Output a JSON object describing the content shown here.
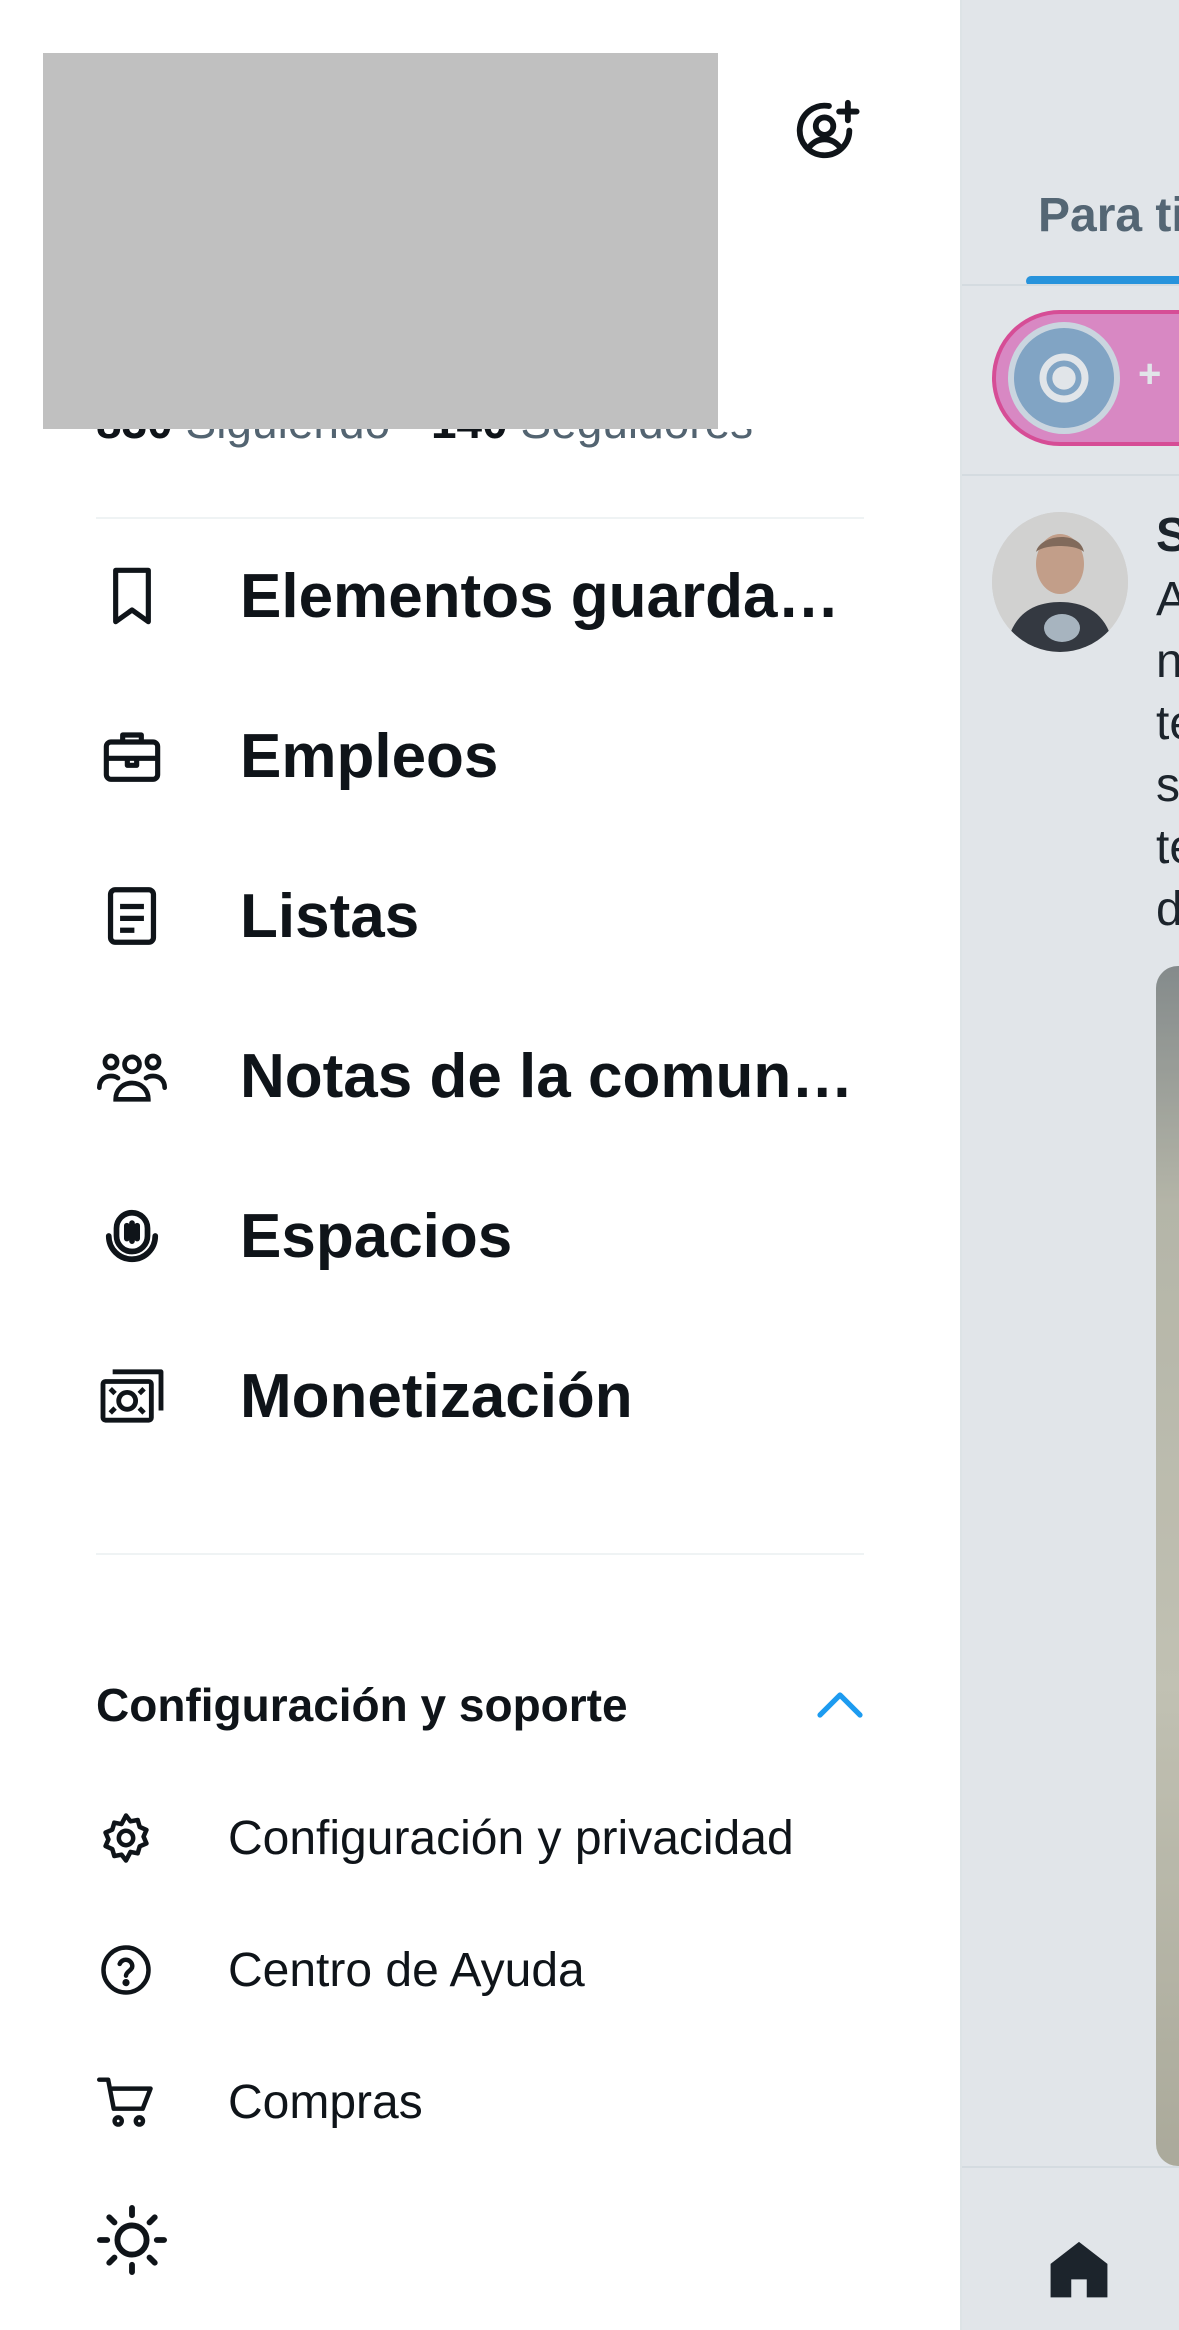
{
  "drawer": {
    "follow": {
      "following_count": "830",
      "following_label": "Siguiendo",
      "followers_count": "140",
      "followers_label": "Seguidores"
    },
    "menu": [
      {
        "label": "Elementos guardados",
        "icon": "bookmark-icon"
      },
      {
        "label": "Empleos",
        "icon": "briefcase-icon"
      },
      {
        "label": "Listas",
        "icon": "list-icon"
      },
      {
        "label": "Notas de la comunidad",
        "icon": "community-notes-icon"
      },
      {
        "label": "Espacios",
        "icon": "spaces-icon"
      },
      {
        "label": "Monetización",
        "icon": "money-icon"
      }
    ],
    "settings_section": {
      "title": "Configuración y soporte",
      "items": [
        {
          "label": "Configuración y privacidad",
          "icon": "gear-icon"
        },
        {
          "label": "Centro de Ayuda",
          "icon": "help-icon"
        },
        {
          "label": "Compras",
          "icon": "cart-icon"
        }
      ]
    }
  },
  "feed": {
    "tab_label": "Para ti",
    "spaces_pill_text": "+",
    "post": {
      "name_initial": "S",
      "text_lines": [
        "A",
        "n",
        "te",
        "s",
        "te",
        "d"
      ]
    }
  },
  "colors": {
    "accent": "#1d9bf0",
    "text": "#0f1419",
    "muted": "#536471",
    "spaces_pink": "#f58ed1"
  }
}
